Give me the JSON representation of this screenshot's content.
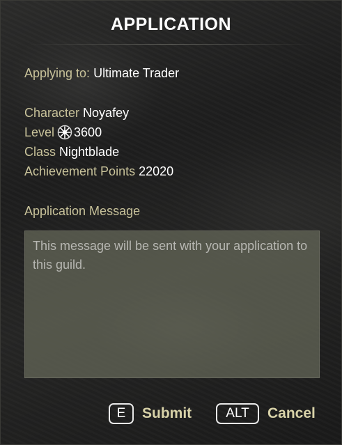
{
  "dialog": {
    "title": "APPLICATION"
  },
  "guild": {
    "label": "Applying to:",
    "name": "Ultimate Trader"
  },
  "character": {
    "name_label": "Character",
    "name": "Noyafey",
    "level_label": "Level",
    "level_icon": "champion-point-icon",
    "level": "3600",
    "class_label": "Class",
    "class": "Nightblade",
    "achievement_label": "Achievement Points",
    "achievement_points": "22020"
  },
  "message": {
    "label": "Application Message",
    "placeholder": "This message will be sent with your application to this guild.",
    "value": ""
  },
  "actions": {
    "submit_key": "E",
    "submit_label": "Submit",
    "cancel_key": "ALT",
    "cancel_label": "Cancel"
  }
}
